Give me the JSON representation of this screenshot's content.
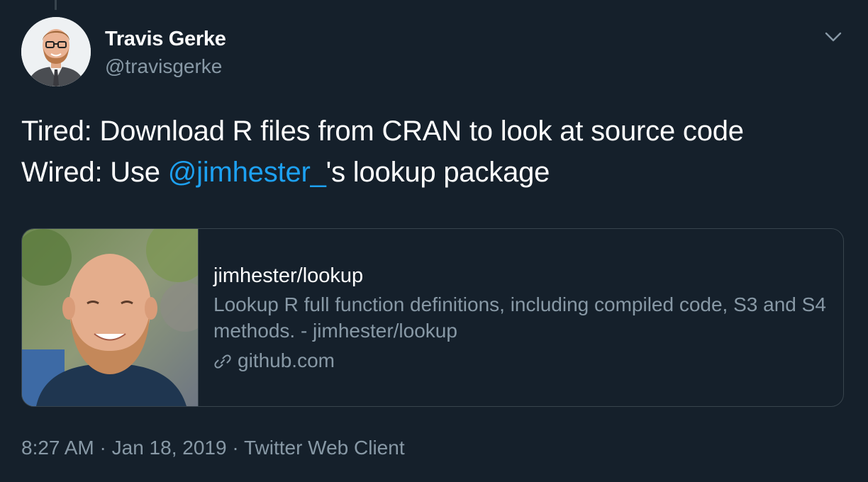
{
  "author": {
    "name": "Travis Gerke",
    "handle": "@travisgerke"
  },
  "tweet": {
    "line1": "Tired: Download R files from CRAN to look at source code",
    "line2_prefix": "Wired: Use ",
    "mention": "@jimhester_",
    "line2_suffix": "'s lookup package"
  },
  "card": {
    "title": "jimhester/lookup",
    "description": "Lookup R full function definitions, including compiled code, S3 and S4 methods. - jimhester/lookup",
    "domain": "github.com"
  },
  "meta": {
    "time": "8:27 AM",
    "sep1": " · ",
    "date": "Jan 18, 2019",
    "sep2": " · ",
    "client": "Twitter Web Client"
  },
  "colors": {
    "background": "#15202b",
    "link": "#1da1f2",
    "secondary_text": "#8899a6",
    "border": "#38444d"
  },
  "icons": {
    "more": "chevron-down-icon",
    "card_link": "link-icon"
  }
}
